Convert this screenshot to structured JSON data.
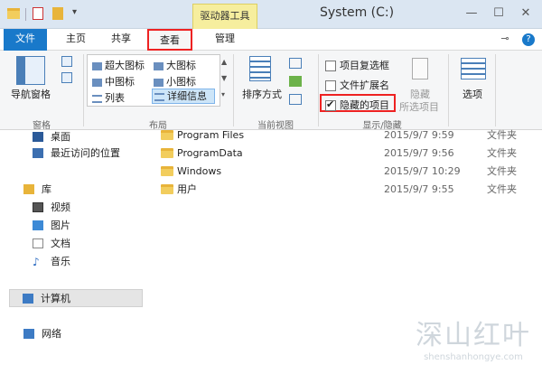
{
  "titlebar": {
    "context_tab": "驱动器工具",
    "window_title": "System (C:)",
    "quick_access_arrow": "▾",
    "minimize": "—",
    "maximize": "☐",
    "close": "✕"
  },
  "tabs": {
    "file": "文件",
    "home": "主页",
    "share": "共享",
    "view": "查看",
    "manage": "管理",
    "pin": "⊸",
    "help": "?"
  },
  "ribbon": {
    "panes": {
      "nav_pane": "导航窗格",
      "label": "窗格"
    },
    "layout": {
      "label": "布局",
      "items": [
        "超大图标",
        "大图标",
        "中图标",
        "小图标",
        "列表",
        "详细信息"
      ]
    },
    "current_view": {
      "sort_by": "排序方式",
      "label": "当前视图"
    },
    "show_hide": {
      "label": "显示/隐藏",
      "item_checkboxes": "项目复选框",
      "file_extensions": "文件扩展名",
      "hidden_items": "隐藏的项目",
      "hide_selected_line1": "隐藏",
      "hide_selected_line2": "所选项目"
    },
    "options": "选项"
  },
  "nav": {
    "desktop": "桌面",
    "recent": "最近访问的位置",
    "libraries": "库",
    "videos": "视频",
    "pictures": "图片",
    "documents": "文档",
    "music": "音乐",
    "computer": "计算机",
    "network": "网络"
  },
  "files": [
    {
      "name": "Program Files",
      "date": "2015/9/7 9:59",
      "type": "文件夹"
    },
    {
      "name": "ProgramData",
      "date": "2015/9/7 9:56",
      "type": "文件夹"
    },
    {
      "name": "Windows",
      "date": "2015/9/7 10:29",
      "type": "文件夹"
    },
    {
      "name": "用户",
      "date": "2015/9/7 9:55",
      "type": "文件夹"
    }
  ],
  "watermark": {
    "cn": "深山红叶",
    "en": "shenshanhongye.com"
  },
  "colors": {
    "file_tab": "#1979ca",
    "highlight_box": "#e22222",
    "context_tab": "#f6ee9e"
  }
}
